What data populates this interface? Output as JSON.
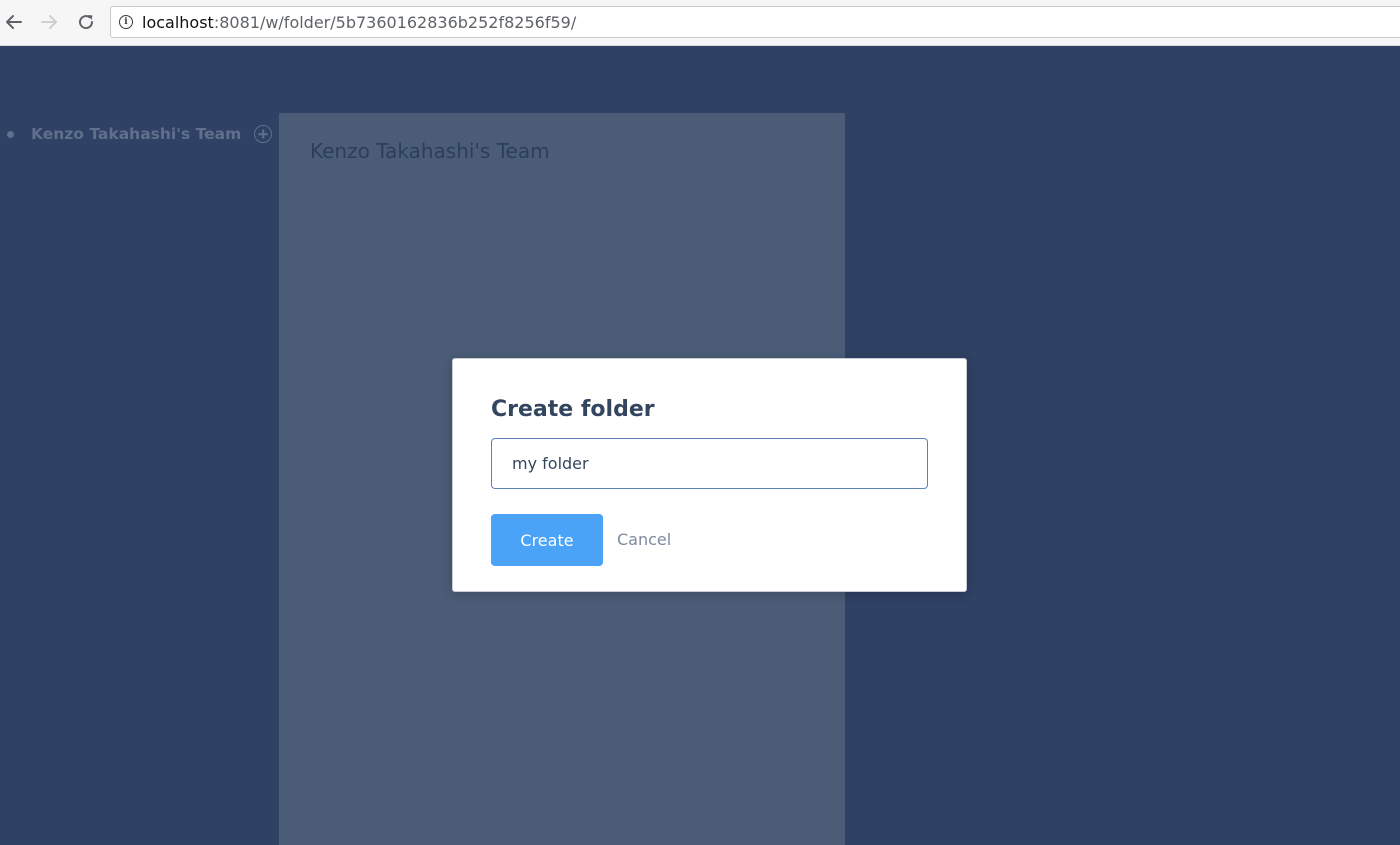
{
  "browser": {
    "url_host": "localhost",
    "url_path": ":8081/w/folder/5b7360162836b252f8256f59/",
    "info_icon": "info-icon",
    "back_icon": "arrow-left-icon",
    "forward_icon": "arrow-right-icon",
    "reload_icon": "reload-icon"
  },
  "sidebar": {
    "team_name": "Kenzo Takahashi's Team",
    "add_icon": "plus-circle-icon"
  },
  "panel": {
    "title": "Kenzo Takahashi's Team"
  },
  "modal": {
    "title": "Create folder",
    "input_value": "my folder",
    "create_label": "Create",
    "cancel_label": "Cancel"
  },
  "colors": {
    "background": "#2f4164",
    "panel": "#4a5c76",
    "primary_button": "#4aa3f7",
    "modal_title": "#34465f"
  }
}
